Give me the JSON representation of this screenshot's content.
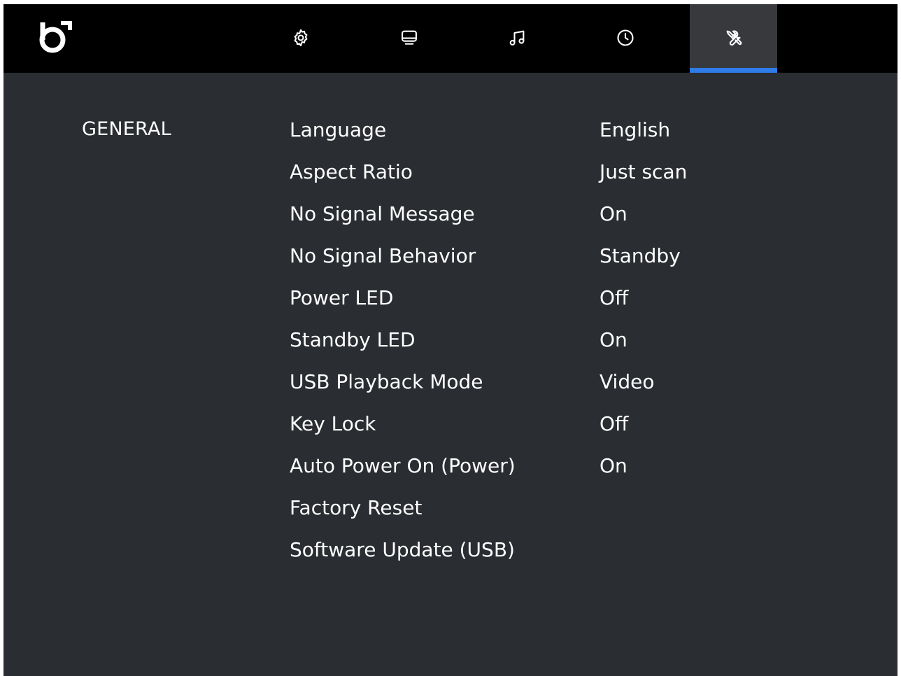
{
  "nav": {
    "tabs": [
      {
        "icon": "gear-icon",
        "active": false
      },
      {
        "icon": "monitor-icon",
        "active": false
      },
      {
        "icon": "music-note-icon",
        "active": false
      },
      {
        "icon": "clock-icon",
        "active": false
      },
      {
        "icon": "wrench-screwdriver-icon",
        "active": true
      }
    ],
    "accent_color": "#2f7be8"
  },
  "main": {
    "category": "GENERAL",
    "settings": [
      {
        "label": "Language",
        "value": "English"
      },
      {
        "label": "Aspect Ratio",
        "value": "Just scan"
      },
      {
        "label": "No Signal Message",
        "value": "On"
      },
      {
        "label": "No Signal Behavior",
        "value": "Standby"
      },
      {
        "label": "Power LED",
        "value": "Off"
      },
      {
        "label": "Standby LED",
        "value": "On"
      },
      {
        "label": "USB Playback Mode",
        "value": "Video"
      },
      {
        "label": "Key Lock",
        "value": "Off"
      },
      {
        "label": "Auto Power On (Power)",
        "value": "On"
      },
      {
        "label": "Factory Reset",
        "value": ""
      },
      {
        "label": "Software Update (USB)",
        "value": ""
      }
    ]
  },
  "colors": {
    "topbar": "#000000",
    "background": "#2a2d31",
    "active_tab": "#37393d",
    "text": "#ffffff"
  }
}
